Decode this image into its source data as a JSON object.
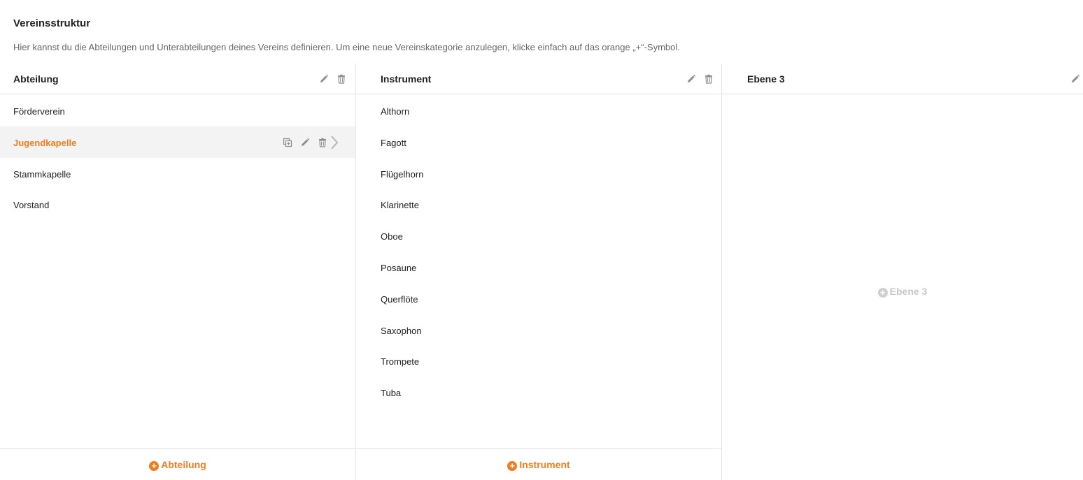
{
  "page": {
    "title": "Vereinsstruktur",
    "description": "Hier kannst du die Abteilungen und Unterabteilungen deines Vereins definieren. Um eine neue Vereinskategorie anzulegen, klicke einfach auf das orange „+“-Symbol."
  },
  "colors": {
    "accent": "#f07d1e",
    "muted": "#c8c8c8",
    "selected_bg": "#f3f3f3"
  },
  "columns": [
    {
      "title": "Abteilung",
      "items": [
        "Förderverein",
        "Jugendkapelle",
        "Stammkapelle",
        "Vorstand"
      ],
      "selected_index": 1,
      "add_label": "Abteilung",
      "header_icons": [
        "pencil-icon",
        "trash-icon"
      ],
      "row_icons": [
        "copy-icon",
        "pencil-icon",
        "trash-icon",
        "chevron-right-icon"
      ]
    },
    {
      "title": "Instrument",
      "items": [
        "Althorn",
        "Fagott",
        "Flügelhorn",
        "Klarinette",
        "Oboe",
        "Posaune",
        "Querflöte",
        "Saxophon",
        "Trompete",
        "Tuba"
      ],
      "add_label": "Instrument",
      "header_icons": [
        "pencil-icon",
        "trash-icon"
      ]
    },
    {
      "title": "Ebene 3",
      "items": [],
      "add_label": "Ebene 3",
      "header_icons": [
        "pencil-icon"
      ]
    }
  ]
}
